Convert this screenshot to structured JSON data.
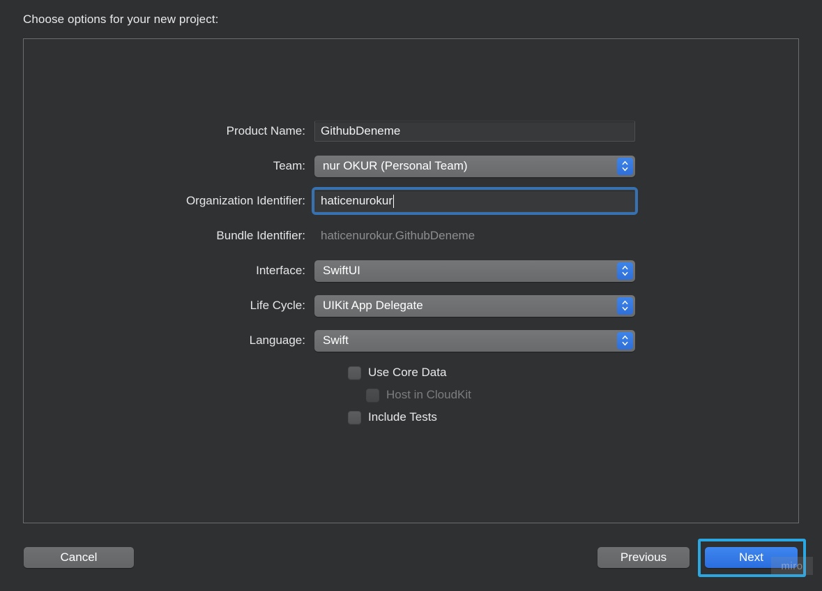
{
  "dialog": {
    "title": "Choose options for your new project:"
  },
  "form": {
    "rows": [
      {
        "label": "Product Name:",
        "value": "GithubDeneme",
        "type": "textfield"
      },
      {
        "label": "Team:",
        "value": "nur OKUR (Personal Team)",
        "type": "popup"
      },
      {
        "label": "Organization Identifier:",
        "value": "haticenurokur",
        "type": "textfield-focused"
      },
      {
        "label": "Bundle Identifier:",
        "value": "haticenurokur.GithubDeneme",
        "type": "static"
      },
      {
        "label": "Interface:",
        "value": "SwiftUI",
        "type": "popup"
      },
      {
        "label": "Life Cycle:",
        "value": "UIKit App Delegate",
        "type": "popup"
      },
      {
        "label": "Language:",
        "value": "Swift",
        "type": "popup"
      }
    ],
    "checkboxes": [
      {
        "label": "Use Core Data",
        "checked": false,
        "disabled": false
      },
      {
        "label": "Host in CloudKit",
        "checked": false,
        "disabled": true
      },
      {
        "label": "Include Tests",
        "checked": false,
        "disabled": false
      }
    ]
  },
  "buttons": {
    "cancel": "Cancel",
    "previous": "Previous",
    "next": "Next"
  },
  "watermark": {
    "text": "miro"
  },
  "colors": {
    "window_bg": "#2e3032",
    "panel_bg": "#2f3133",
    "panel_border": "#6b6d6f",
    "popup_bg": "#6d6f71",
    "stepper_blue": "#3276e0",
    "next_button_blue": "#3579e6",
    "focus_ring_blue": "#3a76ba",
    "highlight_cyan": "#2ca6e0",
    "text_primary": "#e9e9ea",
    "text_disabled": "#7b7d7f"
  }
}
